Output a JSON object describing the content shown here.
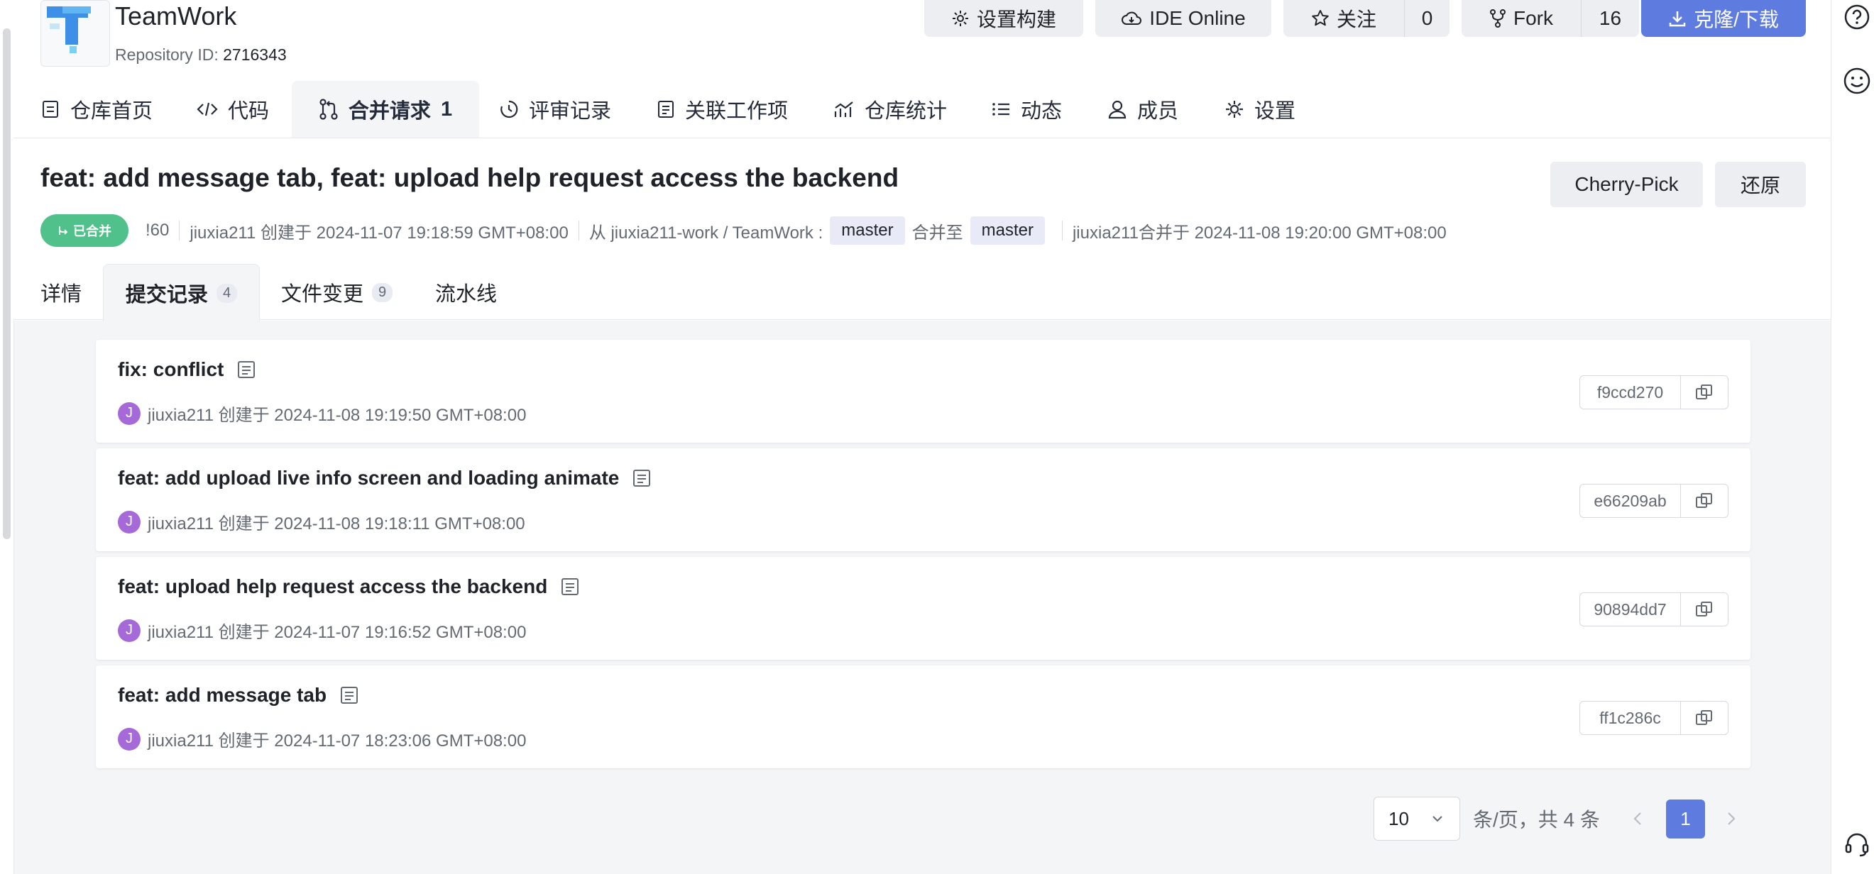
{
  "repo": {
    "name": "TeamWork",
    "id_label": "Repository ID:",
    "id_value": "2716343"
  },
  "header_buttons": {
    "settings_build": "设置构建",
    "ide_online": "IDE Online",
    "follow": "关注",
    "follow_count": "0",
    "fork": "Fork",
    "fork_count": "16",
    "clone": "克隆/下载"
  },
  "nav": {
    "home": "仓库首页",
    "code": "代码",
    "merge_requests": "合并请求",
    "merge_requests_count": "1",
    "reviews": "评审记录",
    "work_items": "关联工作项",
    "stats": "仓库统计",
    "activity": "动态",
    "members": "成员",
    "settings": "设置"
  },
  "pr": {
    "title": "feat: add message tab, feat: upload help request access the backend",
    "cherry_pick": "Cherry-Pick",
    "revert": "还原",
    "status": "已合并",
    "number": "!60",
    "created": "jiuxia211 创建于 2024-11-07 19:18:59 GMT+08:00",
    "from_label": "从 jiuxia211-work / TeamWork :",
    "source_branch": "master",
    "into_label": "合并至",
    "target_branch": "master",
    "merged_info": "jiuxia211合并于 2024-11-08 19:20:00 GMT+08:00"
  },
  "subtabs": {
    "details": "详情",
    "commits": "提交记录",
    "commits_count": "4",
    "files": "文件变更",
    "files_count": "9",
    "pipeline": "流水线"
  },
  "commits": [
    {
      "title": "fix: conflict",
      "avatar": "J",
      "meta": "jiuxia211 创建于 2024-11-08 19:19:50 GMT+08:00",
      "sha": "f9ccd270"
    },
    {
      "title": "feat: add upload live info screen and loading animate",
      "avatar": "J",
      "meta": "jiuxia211 创建于 2024-11-08 19:18:11 GMT+08:00",
      "sha": "e66209ab"
    },
    {
      "title": "feat: upload help request access the backend",
      "avatar": "J",
      "meta": "jiuxia211 创建于 2024-11-07 19:16:52 GMT+08:00",
      "sha": "90894dd7"
    },
    {
      "title": "feat: add message tab",
      "avatar": "J",
      "meta": "jiuxia211 创建于 2024-11-07 18:23:06 GMT+08:00",
      "sha": "ff1c286c"
    }
  ],
  "pagination": {
    "page_size": "10",
    "summary": "条/页，共 4 条",
    "current_page": "1"
  },
  "colors": {
    "primary": "#5e7ce0",
    "merged": "#50c18b",
    "avatar": "#a66ad8",
    "page_bg": "#f4f5f7"
  }
}
